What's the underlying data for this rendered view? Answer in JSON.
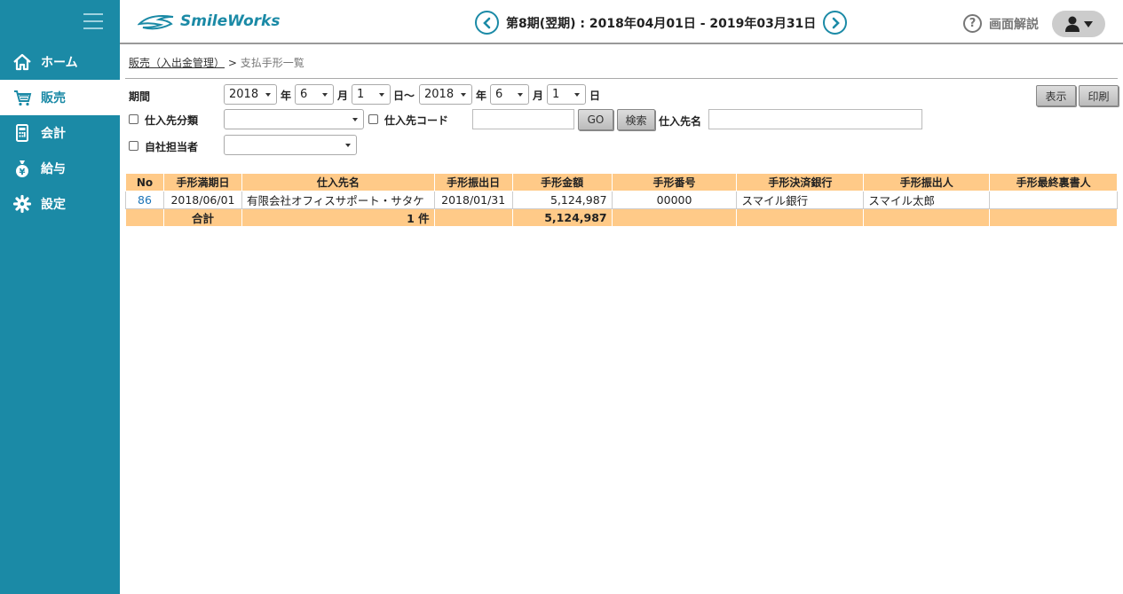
{
  "sidebar": {
    "items": [
      {
        "label": "ホーム",
        "icon": "home-icon"
      },
      {
        "label": "販売",
        "icon": "cart-icon"
      },
      {
        "label": "会計",
        "icon": "calculator-icon"
      },
      {
        "label": "給与",
        "icon": "money-bag-icon"
      },
      {
        "label": "設定",
        "icon": "gear-icon"
      }
    ],
    "active_index": 1
  },
  "header": {
    "logo": "SmileWorks",
    "period": "第8期(翌期) : 2018年04月01日 - 2019年03月31日",
    "help": "画面解説"
  },
  "breadcrumb": {
    "parent": "販売（入出金管理）",
    "separator": ">",
    "current": "支払手形一覧"
  },
  "form": {
    "period_label": "期間",
    "from_year": "2018",
    "from_month": "6",
    "from_day": "1",
    "to_year": "2018",
    "to_month": "6",
    "to_day": "1",
    "unit_year": "年",
    "unit_month": "月",
    "unit_day_from": "日〜",
    "unit_day": "日",
    "supplier_category_label": "仕入先分類",
    "supplier_category_value": "",
    "supplier_code_label": "仕入先コード",
    "supplier_code_value": "",
    "go_button": "GO",
    "search_button": "検索",
    "supplier_name_label": "仕入先名",
    "supplier_name_value": "",
    "person_label": "自社担当者",
    "person_value": "",
    "show_button": "表示",
    "print_button": "印刷"
  },
  "table": {
    "headers": [
      "No",
      "手形満期日",
      "仕入先名",
      "手形振出日",
      "手形金額",
      "手形番号",
      "手形決済銀行",
      "手形振出人",
      "手形最終裏書人"
    ],
    "rows": [
      [
        "86",
        "2018/06/01",
        "有限会社オフィスサポート・サタケ",
        "2018/01/31",
        "5,124,987",
        "00000",
        "スマイル銀行",
        "スマイル太郎",
        ""
      ]
    ],
    "total": {
      "label": "合計",
      "count": "1 件",
      "amount": "5,124,987"
    }
  },
  "colors": {
    "sidebar": "#1b8aa6",
    "table_header": "#ffca88",
    "link": "#1b74b8"
  }
}
